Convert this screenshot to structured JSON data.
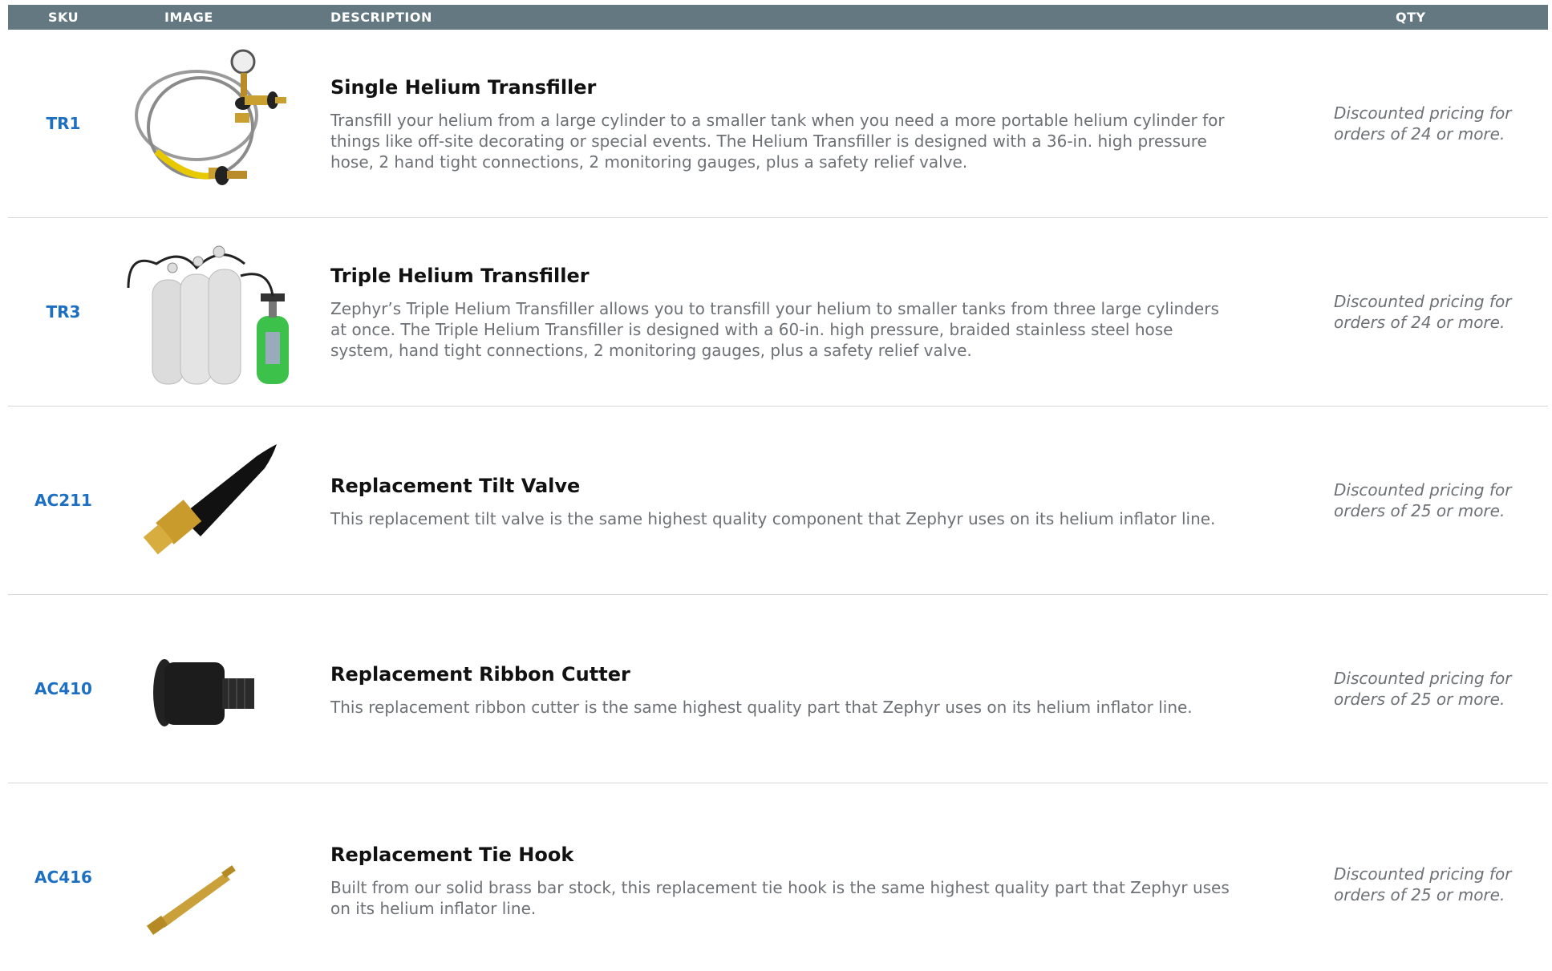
{
  "header": {
    "sku": "SKU",
    "image": "IMAGE",
    "description": "DESCRIPTION",
    "qty": "QTY"
  },
  "colors": {
    "header_bg": "#637881",
    "sku_link": "#1d6fc2",
    "body_text": "#6d7175"
  },
  "products": [
    {
      "sku": "TR1",
      "title": "Single Helium Transfiller",
      "description": "Transfill your helium from a large cylinder to a smaller tank when you need a more portable helium cylinder for things like off-site decorating or special events. The Helium Transfiller is designed with a 36-in. high pressure hose, 2 hand tight connections, 2 monitoring gauges, plus a safety relief valve.",
      "qty_note": "Discounted pricing for orders of 24 or more.",
      "image_icon": "hose-gauge-icon"
    },
    {
      "sku": "TR3",
      "title": "Triple Helium Transfiller",
      "description": "Zephyr’s Triple Helium Transfiller allows you to transfill your helium to smaller tanks from three large cylinders at once. The Triple Helium Transfiller is designed with a 60-in. high pressure, braided stainless steel hose system, hand tight connections, 2 monitoring gauges, plus a safety relief valve.",
      "qty_note": "Discounted pricing for orders of 24 or more.",
      "image_icon": "cylinders-icon"
    },
    {
      "sku": "AC211",
      "title": "Replacement Tilt Valve",
      "description": "This replacement tilt valve is the same highest quality component that Zephyr uses on its helium inflator line.",
      "qty_note": "Discounted pricing for orders of 25 or more.",
      "image_icon": "tilt-valve-icon"
    },
    {
      "sku": "AC410",
      "title": "Replacement Ribbon Cutter",
      "description": "This replacement ribbon cutter is the same highest quality part that Zephyr uses on its helium inflator line.",
      "qty_note": "Discounted pricing for orders of 25 or more.",
      "image_icon": "ribbon-cutter-icon"
    },
    {
      "sku": "AC416",
      "title": "Replacement Tie Hook",
      "description": "Built from our solid brass bar stock, this replacement tie hook is the same highest quality part that Zephyr uses on its helium inflator line.",
      "qty_note": "Discounted pricing for orders of 25 or more.",
      "image_icon": "tie-hook-icon"
    }
  ]
}
